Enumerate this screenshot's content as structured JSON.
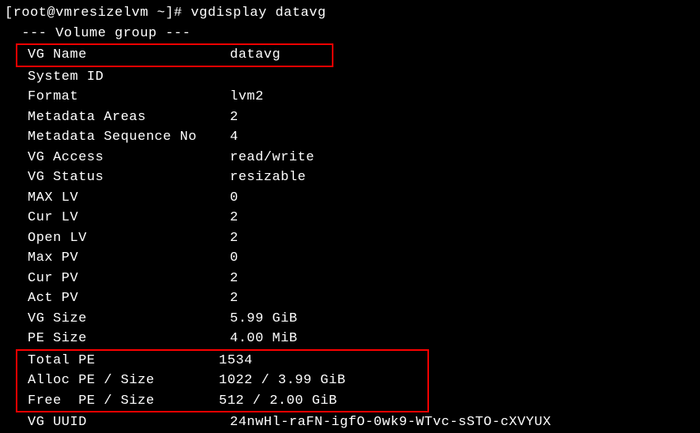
{
  "prompt": {
    "user_host": "[root@vmresizelvm ~]#",
    "command": "vgdisplay datavg"
  },
  "section_header": "  --- Volume group ---",
  "fields": {
    "vg_name": {
      "label": "VG Name",
      "value": "datavg"
    },
    "system_id": {
      "label": "System ID",
      "value": ""
    },
    "format": {
      "label": "Format",
      "value": "lvm2"
    },
    "metadata_areas": {
      "label": "Metadata Areas",
      "value": "2"
    },
    "metadata_seq_no": {
      "label": "Metadata Sequence No",
      "value": "4"
    },
    "vg_access": {
      "label": "VG Access",
      "value": "read/write"
    },
    "vg_status": {
      "label": "VG Status",
      "value": "resizable"
    },
    "max_lv": {
      "label": "MAX LV",
      "value": "0"
    },
    "cur_lv": {
      "label": "Cur LV",
      "value": "2"
    },
    "open_lv": {
      "label": "Open LV",
      "value": "2"
    },
    "max_pv": {
      "label": "Max PV",
      "value": "0"
    },
    "cur_pv": {
      "label": "Cur PV",
      "value": "2"
    },
    "act_pv": {
      "label": "Act PV",
      "value": "2"
    },
    "vg_size": {
      "label": "VG Size",
      "value": "5.99 GiB"
    },
    "pe_size": {
      "label": "PE Size",
      "value": "4.00 MiB"
    },
    "total_pe": {
      "label": "Total PE",
      "value": "1534"
    },
    "alloc_pe": {
      "label": "Alloc PE / Size",
      "value": "1022 / 3.99 GiB"
    },
    "free_pe": {
      "label": "Free  PE / Size",
      "value": "512 / 2.00 GiB"
    },
    "vg_uuid": {
      "label": "VG UUID",
      "value": "24nwHl-raFN-igfO-0wk9-WTvc-sSTO-cXVYUX"
    }
  }
}
